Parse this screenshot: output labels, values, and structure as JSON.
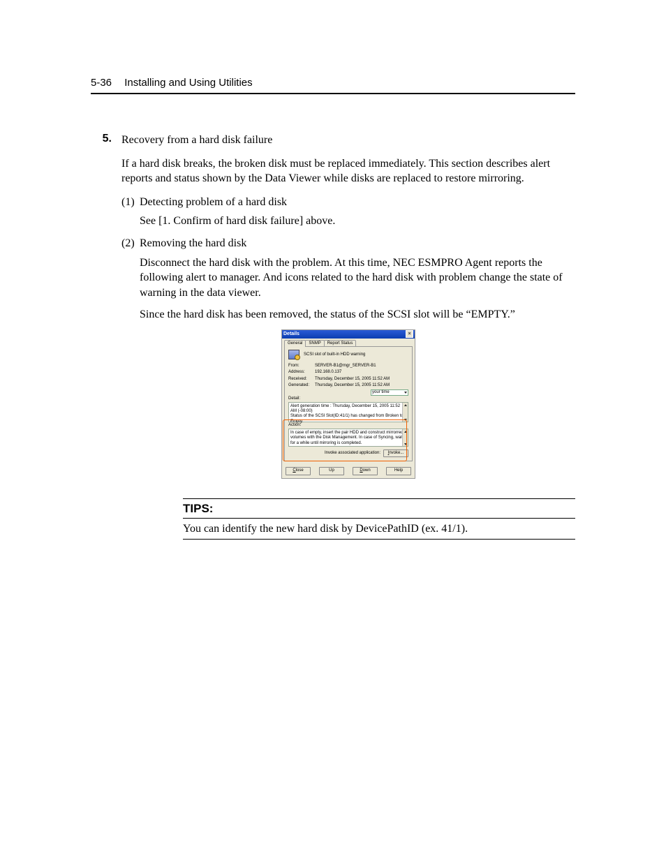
{
  "header": {
    "page_num": "5-36",
    "title": "Installing and Using Utilities"
  },
  "step": {
    "number": "5.",
    "title": "Recovery from a hard disk failure",
    "intro": "If a hard disk breaks, the broken disk must be replaced immediately. This section describes alert reports and status shown by the Data Viewer while disks are replaced to restore mirroring."
  },
  "subs": [
    {
      "num": "(1)",
      "title": "Detecting problem of a hard disk",
      "body": "See [1. Confirm of hard disk failure] above."
    },
    {
      "num": "(2)",
      "title": "Removing the hard disk",
      "body1": "Disconnect the hard disk with the problem. At this time, NEC ESMPRO Agent reports the following alert to manager. And icons related to the hard disk with problem change the state of warning in the data viewer.",
      "body2": "Since the hard disk has been removed, the status of the SCSI slot will be “EMPTY.”"
    }
  ],
  "dialog": {
    "title": "Details",
    "tabs": [
      "General",
      "SNMP",
      "Report Status"
    ],
    "summary": "SCSI slot of built-in HDD warning",
    "fields": {
      "From": "SERVER-B1@mgr_SERVER-B1",
      "Address": "192.168.0.137",
      "Received": "Thursday, December 15, 2005 11:52 AM",
      "Generated": "Thursday, December 15, 2005 11:52 AM"
    },
    "time_selector": "your time",
    "detail_label": "Detail:",
    "detail_text": "Alert generation time : Thursday, December 15, 2005 11:52 AM (-08:00)\nStatus of the SCSI Slot(ID:41/1) has changed from Broken to Empty.",
    "action_label": "Action:",
    "action_text": "In case of empty, insert the pair HDD and construct mirrorred volumes with the Disk Management. In case of Syncing, wait for a while until mirroring is completed.",
    "invoke_label": "Invoke associated application:",
    "buttons": {
      "invoke": "Invoke...",
      "close": "Close",
      "up": "Up",
      "down": "Down",
      "help": "Help"
    }
  },
  "tips": {
    "heading": "TIPS:",
    "body": "You can identify the new hard disk by DevicePathID (ex. 41/1)."
  }
}
